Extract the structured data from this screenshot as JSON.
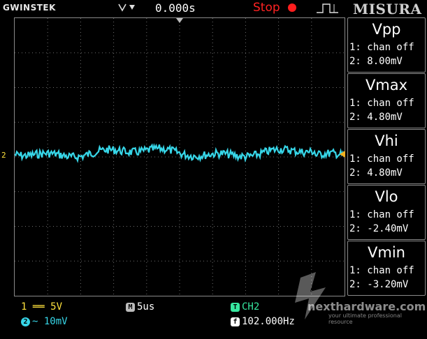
{
  "header": {
    "brand": "GWINSTEK",
    "time_offset": "0.000s",
    "run_status": "Stop",
    "logo_text": "MISURA"
  },
  "channel_marker": "2",
  "measurements": [
    {
      "title": "Vpp",
      "line1": "1: chan off",
      "line2": "2: 8.00mV"
    },
    {
      "title": "Vmax",
      "line1": "1: chan off",
      "line2": "2: 4.80mV"
    },
    {
      "title": "Vhi",
      "line1": "1: chan off",
      "line2": "2: 4.80mV"
    },
    {
      "title": "Vlo",
      "line1": "1: chan off",
      "line2": "2: -2.40mV"
    },
    {
      "title": "Vmin",
      "line1": "1: chan off",
      "line2": "2: -3.20mV"
    }
  ],
  "footer": {
    "ch1_num": "1",
    "ch1_coupling": "══",
    "ch1_scale": "5V",
    "ch2_num": "2",
    "ch2_coupling": "~",
    "ch2_scale": "10mV",
    "timebase_badge": "M",
    "timebase": "5us",
    "trigger_badge": "T",
    "trigger_source": "CH2",
    "freq_badge": "f",
    "frequency": "102.000Hz"
  },
  "watermark": {
    "site": "nexthardware.com",
    "tagline": "your ultimate professional resource"
  },
  "colors": {
    "ch1": "#ffe23d",
    "ch2": "#37d6e8",
    "stop": "#ff2222",
    "grid": "#6f6f6f"
  },
  "icons": {
    "trigger": "trigger-slope-icon",
    "stop": "stop-dot-icon",
    "edge": "rising-edge-icon"
  }
}
